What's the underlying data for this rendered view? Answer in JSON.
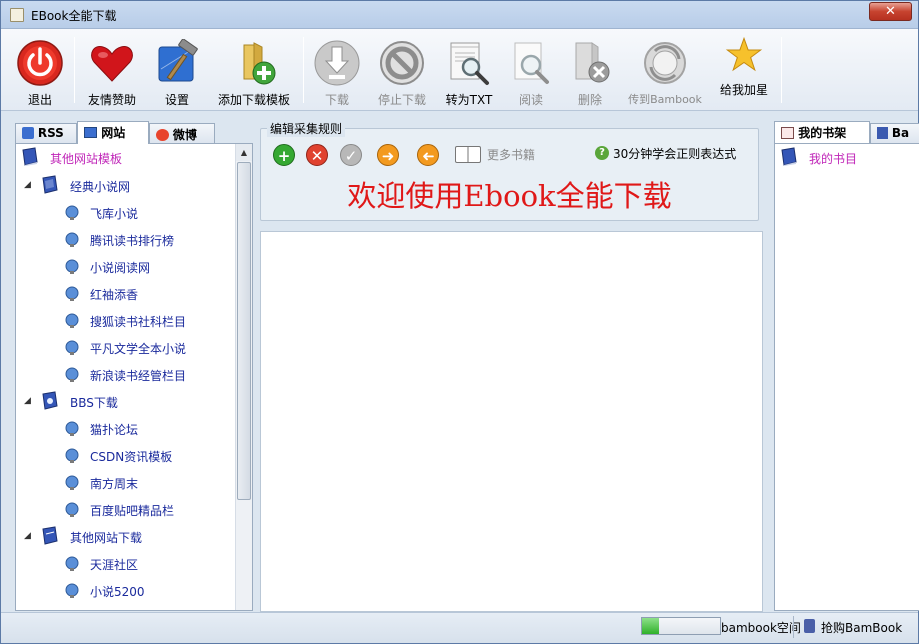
{
  "window": {
    "title": "EBook全能下载",
    "close_label": "✕"
  },
  "toolbar": {
    "buttons": [
      {
        "label": "退出",
        "icon": "power-icon",
        "enabled": true
      },
      {
        "label": "友情赞助",
        "icon": "heart-icon",
        "enabled": true
      },
      {
        "label": "设置",
        "icon": "settings-tools-icon",
        "enabled": true
      },
      {
        "label": "添加下载模板",
        "icon": "add-folder-icon",
        "enabled": true
      },
      {
        "label": "下载",
        "icon": "download-icon",
        "enabled": false
      },
      {
        "label": "停止下载",
        "icon": "stop-icon",
        "enabled": false
      },
      {
        "label": "转为TXT",
        "icon": "convert-txt-icon",
        "enabled": true
      },
      {
        "label": "阅读",
        "icon": "read-magnifier-icon",
        "enabled": false
      },
      {
        "label": "删除",
        "icon": "delete-icon",
        "enabled": false
      },
      {
        "label": "传到Bambook",
        "icon": "sync-bambook-icon",
        "enabled": false
      },
      {
        "label": "给我加星",
        "icon": "star-icon",
        "enabled": true
      }
    ]
  },
  "left_tabs": [
    {
      "label": "RSS",
      "icon": "rss-icon"
    },
    {
      "label": "网站",
      "icon": "network-icon",
      "active": true
    },
    {
      "label": "微博",
      "icon": "weibo-icon"
    }
  ],
  "tree": {
    "root": "其他网站模板",
    "groups": [
      {
        "label": "经典小说网",
        "children": [
          "飞库小说",
          "腾讯读书排行榜",
          "小说阅读网",
          "红袖添香",
          "搜狐读书社科栏目",
          "平凡文学全本小说",
          "新浪读书经管栏目"
        ]
      },
      {
        "label": "BBS下载",
        "children": [
          "猫扑论坛",
          "CSDN资讯模板",
          "南方周末",
          "百度贴吧精品栏"
        ]
      },
      {
        "label": "其他网站下载",
        "children": [
          "天涯社区",
          "小说5200"
        ]
      }
    ]
  },
  "editor": {
    "legend": "编辑采集规则",
    "more_books": "更多书籍",
    "hint": "30分钟学会正则表达式",
    "welcome": "欢迎使用Ebook全能下载",
    "colors": {
      "welcome": "#e01818"
    }
  },
  "right_tabs": [
    {
      "label": "我的书架",
      "icon": "bookshelf-icon",
      "active": true
    },
    {
      "label": "Ba",
      "icon": "bambook-icon"
    }
  ],
  "shelf": {
    "item": "我的书目"
  },
  "status": {
    "progress_fraction": 0.22,
    "space_label": "bambook空间",
    "buy_label": "抢购BamBook"
  }
}
